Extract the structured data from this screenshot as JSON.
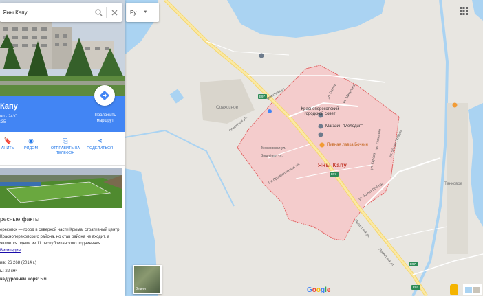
{
  "search": {
    "value": "Яны Капу"
  },
  "lang_select": {
    "value": "Ру"
  },
  "place": {
    "title": "Капу",
    "weather": "но · 24°C",
    "time": ":35",
    "route_label": "Проложить маршрут"
  },
  "actions": [
    {
      "label": "АНИТЬ",
      "icon": "bookmark-icon"
    },
    {
      "label": "РЯДОМ",
      "icon": "nearby-icon"
    },
    {
      "label": "ОТПРАВИТЬ НА ТЕЛЕФОН",
      "icon": "phone-icon"
    },
    {
      "label": "ПОДЕЛИТЬСЯ",
      "icon": "share-icon"
    }
  ],
  "facts": {
    "title": "ресные факты",
    "text": "ерекопск — город в северной части Крыма, стративный центр Красноперекопского района, но став района не входит, а является одним из 11 республиканского подчинения.",
    "link": "Википедия",
    "rows": [
      {
        "key": "ие:",
        "value": "26 268 (2014 г.)"
      },
      {
        "key": "ь:",
        "value": "22 км²"
      },
      {
        "key": "над уровнем моря:",
        "value": "5 м"
      }
    ]
  },
  "map": {
    "city_label": "Яны Капу",
    "district_left": "Совхозное",
    "district_right": "Танковое",
    "poi": {
      "council": "Красноперекопский городской совет",
      "shop": "Магазин \"Мелодия\"",
      "beer": "Пивная лавка Бочкин"
    },
    "streets": [
      "Проектная ул.",
      "Московская ул.",
      "Вишнёвая ул.",
      "1-я Промышленная ул.",
      "ул. Героев",
      "ул. Кирова",
      "ул. Гимназии",
      "ул. Мичурина",
      "ул. 50 лет Победы",
      "ул. 50 лет Победы",
      "Проектная ул.",
      "Проектная ул.",
      "Проектная ул."
    ],
    "route_badges": [
      "E97",
      "E97",
      "E97",
      "E97"
    ],
    "satellite_label": "Земля",
    "google_label": "Google"
  },
  "colors": {
    "accent": "#4285f4",
    "water": "#aad3f2",
    "land": "#e8e6e1",
    "city_fill": "#f2c4c4",
    "city_border": "#e26161",
    "road": "#f7e28a"
  }
}
